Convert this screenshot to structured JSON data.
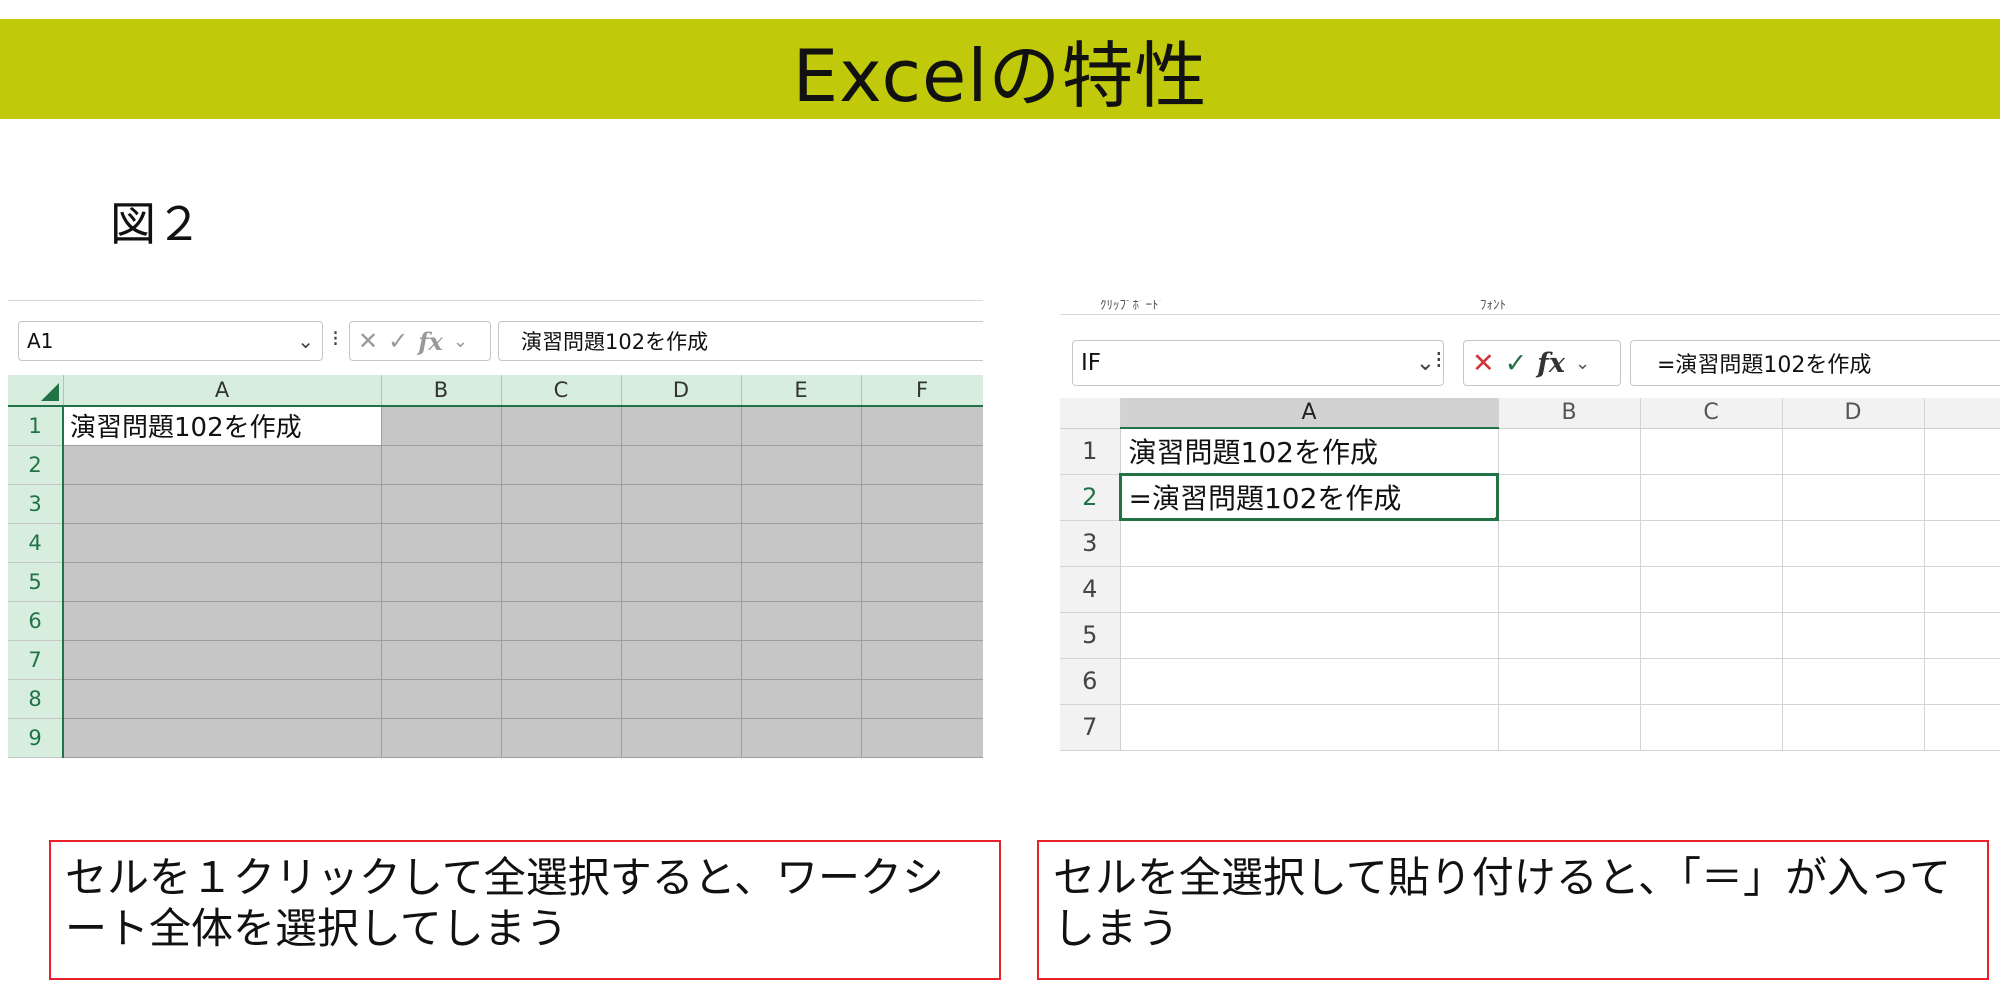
{
  "title": "Excelの特性",
  "figure_label": "図２",
  "left_sheet": {
    "name_box": "A1",
    "formula_content": "演習問題102を作成",
    "columns": [
      "A",
      "B",
      "C",
      "D",
      "E",
      "F"
    ],
    "rows": [
      "1",
      "2",
      "3",
      "4",
      "5",
      "6",
      "7",
      "8",
      "9"
    ],
    "cell_a1": "演習問題102を作成"
  },
  "right_sheet": {
    "ribbon_labels": [
      "ｸﾘｯﾌﾟﾎﾞｰﾄﾞ",
      "ﾌｫﾝﾄ"
    ],
    "name_box": "IF",
    "formula_content": "=演習問題102を作成",
    "columns": [
      "A",
      "B",
      "C",
      "D"
    ],
    "rows": [
      "1",
      "2",
      "3",
      "4",
      "5",
      "6",
      "7"
    ],
    "cell_a1": "演習問題102を作成",
    "cell_a2": "=演習問題102を作成"
  },
  "icons": {
    "dropdown": "chevron-down-icon",
    "cancel": "cancel-x-icon",
    "enter": "checkmark-icon",
    "function": "fx-icon",
    "select_all": "select-all-triangle-icon"
  },
  "captions": {
    "left": "セルを１クリックして全選択すると、ワークシート全体を選択してしまう",
    "right": "セルを全選択して貼り付けると、「＝」が入ってしまう"
  },
  "colors": {
    "title_bar": "#c0c90a",
    "excel_green": "#217346",
    "caption_border": "#e8212a",
    "selected_range": "#c6c6c6"
  }
}
